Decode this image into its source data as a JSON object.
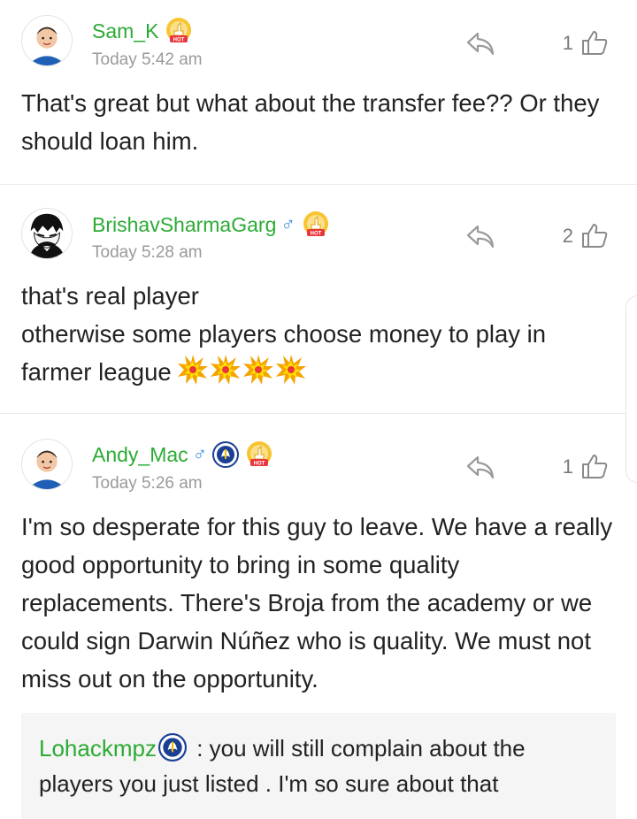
{
  "comments": [
    {
      "username": "Sam_K",
      "gender": "",
      "time": "Today 5:42 am",
      "likes": "1",
      "text": "That's great but what about the transfer fee?? Or they should loan him."
    },
    {
      "username": "BrishavSharmaGarg",
      "gender": "♂",
      "time": "Today 5:28 am",
      "likes": "2",
      "text_line1": "that's real player",
      "text_line2": "otherwise some players choose money to play in",
      "text_line3": "farmer league"
    },
    {
      "username": "Andy_Mac",
      "gender": "♂",
      "time": "Today 5:26 am",
      "likes": "1",
      "text": "I'm so desperate for this guy to leave. We have a really good opportunity to bring in some quality replacements. There's Broja from the academy or we could sign Darwin Núñez who is quality. We must not miss out on the opportunity."
    }
  ],
  "reply": {
    "username": "Lohackmpz",
    "text": " : you will still complain about the players you just listed . I'm so sure about that"
  },
  "badges": {
    "hot_label": "HOT"
  },
  "colors": {
    "username": "#2cab35",
    "gender": "#3d8fe0",
    "text": "#222222",
    "muted": "#9a9a9a"
  }
}
